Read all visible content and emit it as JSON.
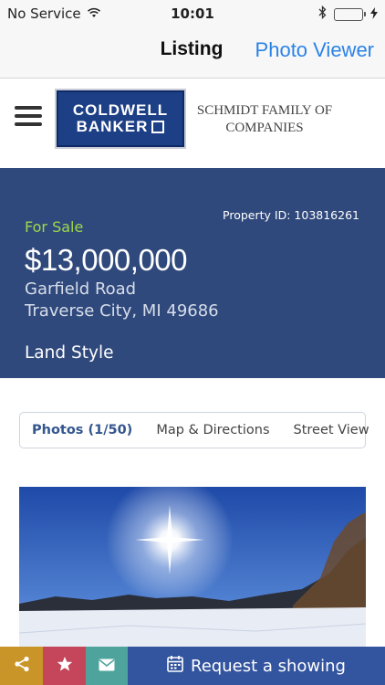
{
  "status_bar": {
    "carrier": "No Service",
    "time": "10:01"
  },
  "nav": {
    "title": "Listing",
    "action": "Photo Viewer"
  },
  "header": {
    "logo_line_1": "COLDWELL",
    "logo_line_2": "BANKER",
    "company_name": "SCHMIDT FAMILY OF COMPANIES"
  },
  "listing": {
    "property_id": "Property ID: 103816261",
    "status": "For Sale",
    "price": "$13,000,000",
    "street": "Garfield Road",
    "city_state_zip": "Traverse City, MI 49686",
    "style": "Land Style"
  },
  "tabs": [
    {
      "label": "Photos (1/50)",
      "active": true
    },
    {
      "label": "Map & Directions",
      "active": false
    },
    {
      "label": "Street View",
      "active": false
    }
  ],
  "bottom_bar": {
    "request_label": "Request a showing"
  },
  "colors": {
    "hero_bg": "#30497c",
    "for_sale": "#9dd84a",
    "link_blue": "#2b83e6",
    "share_bg": "#c99528",
    "favorite_bg": "#c5465b",
    "mail_bg": "#4ea39d",
    "request_bg": "#33549f"
  },
  "icons": {
    "wifi": "wifi-icon",
    "bluetooth": "bluetooth-icon",
    "battery": "battery-icon",
    "charging": "charging-icon",
    "menu": "hamburger-icon",
    "share": "share-icon",
    "favorite": "star-icon",
    "mail": "mail-icon",
    "calendar": "calendar-icon"
  }
}
